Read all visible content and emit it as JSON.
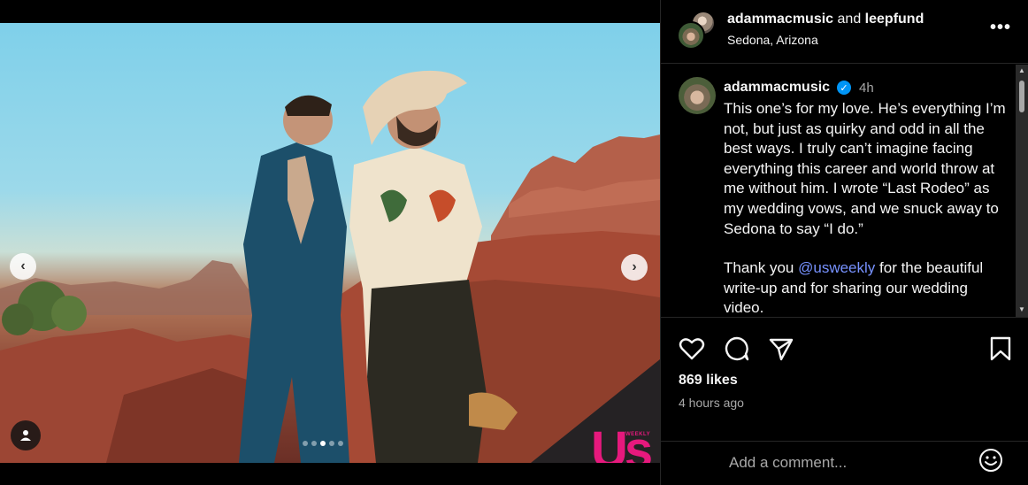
{
  "header": {
    "user1": "adammacmusic",
    "and_text": "and",
    "user2": "leepfund",
    "location": "Sedona, Arizona",
    "more_icon": "more-horizontal-icon"
  },
  "caption": {
    "username": "adammacmusic",
    "verified_icon": "verified-badge-icon",
    "time": "4h",
    "paragraph1": "This one’s for my love. He’s everything I’m not, but just as quirky and odd in all the best ways. I truly can’t imagine facing everything this career and world throw at me without him. I wrote “Last Rodeo” as my wedding vows, and we snuck away to Sedona to say “I do.”",
    "p2_before": "Thank you ",
    "p2_mention": "@usweekly",
    "p2_after": " for the beautiful write-up and for sharing our wedding video."
  },
  "media": {
    "watermark_logo": "Us",
    "watermark_small": "WEEKLY",
    "prev_icon": "chevron-left-icon",
    "next_icon": "chevron-right-icon",
    "carousel_dots": 5,
    "active_dot": 2
  },
  "actions": {
    "likes": "869 likes",
    "posted": "4 hours ago",
    "icons": [
      "heart-icon",
      "comment-icon",
      "share-icon",
      "bookmark-icon"
    ]
  },
  "comment": {
    "placeholder": "Add a comment...",
    "emoji_icon": "emoji-icon"
  }
}
